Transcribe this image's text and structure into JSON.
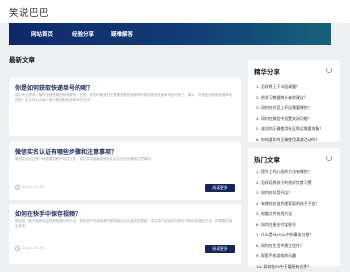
{
  "header": {
    "site_name": "笑说巴巴"
  },
  "nav": {
    "items": [
      "网站首页",
      "经验分享",
      "疑难解答"
    ]
  },
  "main": {
    "section_title": "最新文章",
    "articles": [
      {
        "title": "你是如何获取快递单号的呢？",
        "excerpt": "我们专业提供、随时全程查看的物流服务。但是，有的时候我们在需要查看快递单的时候却发现快递单号找不到了，那么，你是如何获取快递单号的呢？本文将为大家介绍几种获取快递单号的方法。",
        "date": "2022-11-30",
        "button": "阅读更多"
      },
      {
        "title": "微信实名认证有哪些步骤和注意事项？",
        "excerpt": "微信实名认证是一种重要的账户验证方式，本文将详细阐述微信实名认证的步骤和注意事项。",
        "date": "2022-11-30",
        "button": "阅读更多"
      },
      {
        "title": "如何在快手中保存视频？",
        "excerpt": "快手是一款非常受欢迎的短视频分享平台，很多用户在刷视频时都想保存自己喜欢的视频。本文将介绍如何在快手中保存视频的方法，供需要的朋友参考。",
        "date": "2022-11-30",
        "button": "阅读更多"
      }
    ]
  },
  "sidebar": {
    "recommended": {
      "title": "精华分享",
      "items": [
        "1. 怎样将上下半段调整？",
        "2. 给学习数据统计者的建议？",
        "3. 如何在抖音上开店需要哪些？",
        "4. 如何在微信中设置关闭功能？",
        "5. 该如何正确使用社区购买需要准备？",
        "6. 你知道如何正确使用满减活动吗？"
      ]
    },
    "hot": {
      "title": "热门文章",
      "items": [
        "1. 提升工作心态的方法有哪些？",
        "2. 怎样培养孩子的良好饮食习惯",
        "3. 如何在抖音开店？",
        "4. 有哪些应该合理家庭的孩子子女？",
        "5. 电脑文件夹用方法",
        "6. 如何注册支付宝账号",
        "7. 什么是MySQL中的事务与锁？",
        "8. 如何在生活中建立信任？",
        "9. 探索手机游戏的乐趣",
        "10. 如何在PS中下载所有文件？"
      ]
    }
  }
}
